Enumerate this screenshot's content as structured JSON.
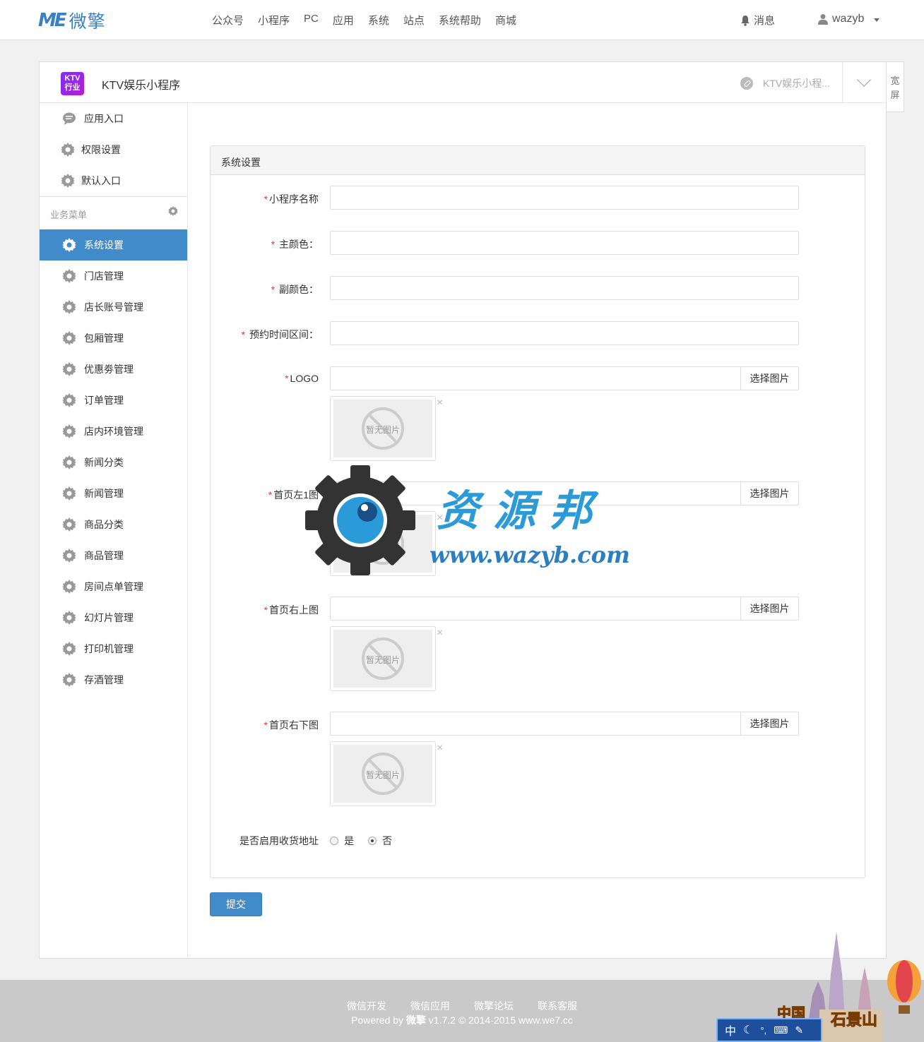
{
  "header": {
    "logo_me": "ME",
    "logo_cn": "微擎",
    "nav": [
      "公众号",
      "小程序",
      "PC",
      "应用",
      "系统",
      "站点",
      "系统帮助",
      "商城"
    ],
    "messages": "消息",
    "username": "wazyb"
  },
  "app": {
    "badge_line1": "KTV",
    "badge_line2": "行业",
    "name": "KTV娱乐小程序",
    "switcher": "KTV娱乐小程...",
    "widescreen": "宽屏"
  },
  "sidebar": {
    "top_items": [
      "应用入口",
      "权限设置",
      "默认入口"
    ],
    "group_title": "业务菜单",
    "items": [
      "系统设置",
      "门店管理",
      "店长账号管理",
      "包厢管理",
      "优惠劵管理",
      "订单管理",
      "店内环境管理",
      "新闻分类",
      "新闻管理",
      "商品分类",
      "商品管理",
      "房间点单管理",
      "幻灯片管理",
      "打印机管理",
      "存酒管理"
    ],
    "active_index": 0
  },
  "form": {
    "title": "系统设置",
    "fields": {
      "name": {
        "label": "小程序名称",
        "value": ""
      },
      "main_color": {
        "label": "主颜色：",
        "value": ""
      },
      "sub_color": {
        "label": "副颜色：",
        "value": ""
      },
      "booking": {
        "label": "预约时间区间：",
        "value": ""
      },
      "logo": {
        "label": "LOGO",
        "value": ""
      },
      "home_left": {
        "label": "首页左1图",
        "value": ""
      },
      "home_right_top": {
        "label": "首页右上图",
        "value": ""
      },
      "home_right_bottom": {
        "label": "首页右下图",
        "value": ""
      }
    },
    "choose_image": "选择图片",
    "no_image": "暂无图片",
    "remove": "×",
    "address_label": "是否启用收货地址",
    "radio_yes": "是",
    "radio_no": "否",
    "address_selected": "否",
    "submit": "提交"
  },
  "watermark": {
    "cn": "资源邦",
    "url": "www.wazyb.com"
  },
  "footer": {
    "links": [
      "微信开发",
      "微信应用",
      "微擎论坛",
      "联系客服"
    ],
    "copy_prefix": "Powered by ",
    "copy_brand": "微擎",
    "copy_suffix": " v1.7.2 © 2014-2015 www.we7.cc"
  },
  "ime": {
    "mode": "中",
    "castle_text1": "中国",
    "castle_text2": "石景山"
  }
}
